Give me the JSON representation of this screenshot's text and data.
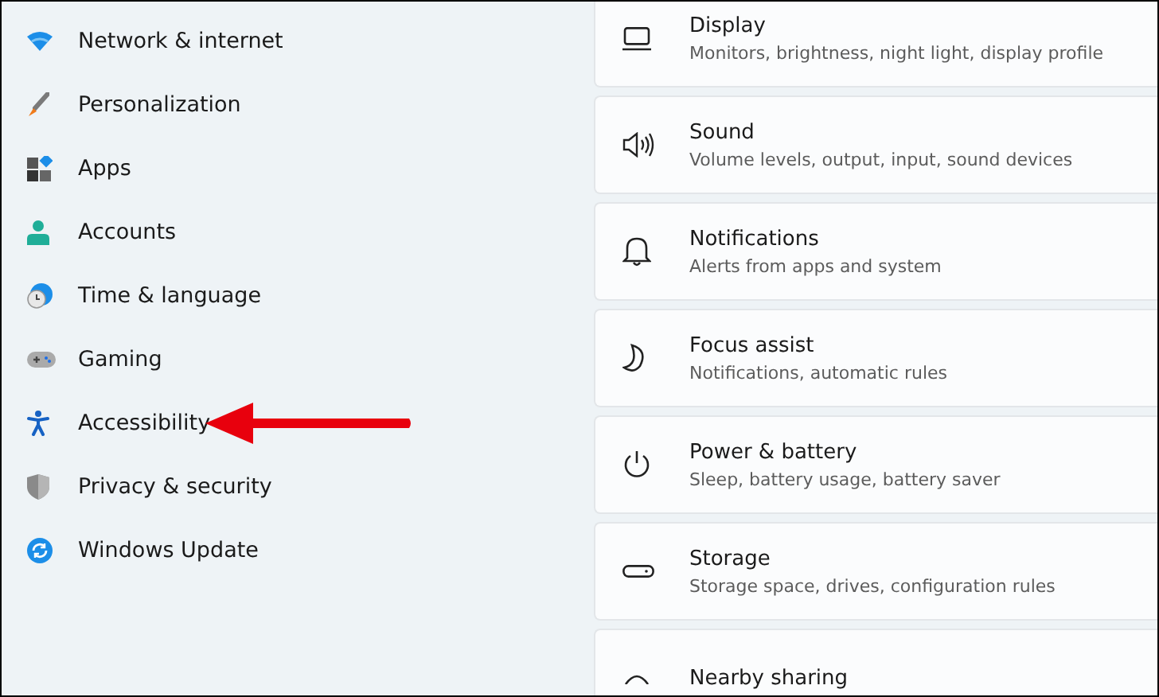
{
  "sidebar": {
    "items": [
      {
        "label": "Network & internet",
        "selected": false
      },
      {
        "label": "Personalization",
        "selected": false
      },
      {
        "label": "Apps",
        "selected": false
      },
      {
        "label": "Accounts",
        "selected": false
      },
      {
        "label": "Time & language",
        "selected": false
      },
      {
        "label": "Gaming",
        "selected": false
      },
      {
        "label": "Accessibility",
        "selected": false,
        "pointer_arrow": true
      },
      {
        "label": "Privacy & security",
        "selected": false
      },
      {
        "label": "Windows Update",
        "selected": false
      }
    ]
  },
  "settings": [
    {
      "title": "Display",
      "description": "Monitors, brightness, night light, display profile"
    },
    {
      "title": "Sound",
      "description": "Volume levels, output, input, sound devices"
    },
    {
      "title": "Notifications",
      "description": "Alerts from apps and system"
    },
    {
      "title": "Focus assist",
      "description": "Notifications, automatic rules"
    },
    {
      "title": "Power & battery",
      "description": "Sleep, battery usage, battery saver"
    },
    {
      "title": "Storage",
      "description": "Storage space, drives, configuration rules"
    },
    {
      "title": "Nearby sharing"
    }
  ]
}
